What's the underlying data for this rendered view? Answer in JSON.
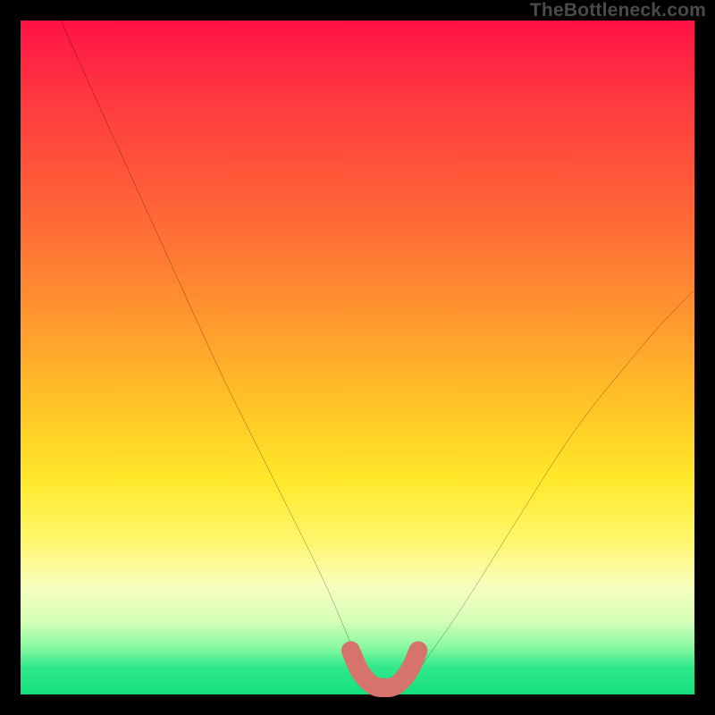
{
  "watermark": "TheBottleneck.com",
  "chart_data": {
    "type": "line",
    "title": "",
    "xlabel": "",
    "ylabel": "",
    "xlim": [
      0,
      100
    ],
    "ylim": [
      0,
      100
    ],
    "series": [
      {
        "name": "bottleneck-curve",
        "color": "#000000",
        "x": [
          6,
          10,
          15,
          20,
          25,
          30,
          35,
          40,
          45,
          48,
          50,
          52,
          54,
          56,
          58,
          60,
          65,
          70,
          75,
          80,
          85,
          90,
          95,
          100
        ],
        "y": [
          100,
          91,
          80,
          69,
          58,
          47,
          37,
          27,
          17,
          10,
          5,
          2,
          1,
          1,
          2,
          5,
          12,
          20,
          28,
          36,
          43,
          49,
          55,
          60
        ]
      },
      {
        "name": "optimal-zone-marker",
        "color": "#d6736b",
        "x": [
          49,
          50,
          51,
          52,
          53,
          54,
          55,
          56,
          57,
          58,
          59
        ],
        "y": [
          6.5,
          4,
          2.5,
          1.5,
          1,
          1,
          1,
          1.5,
          2.5,
          4,
          6.5
        ]
      }
    ],
    "grid": false,
    "legend": false
  }
}
